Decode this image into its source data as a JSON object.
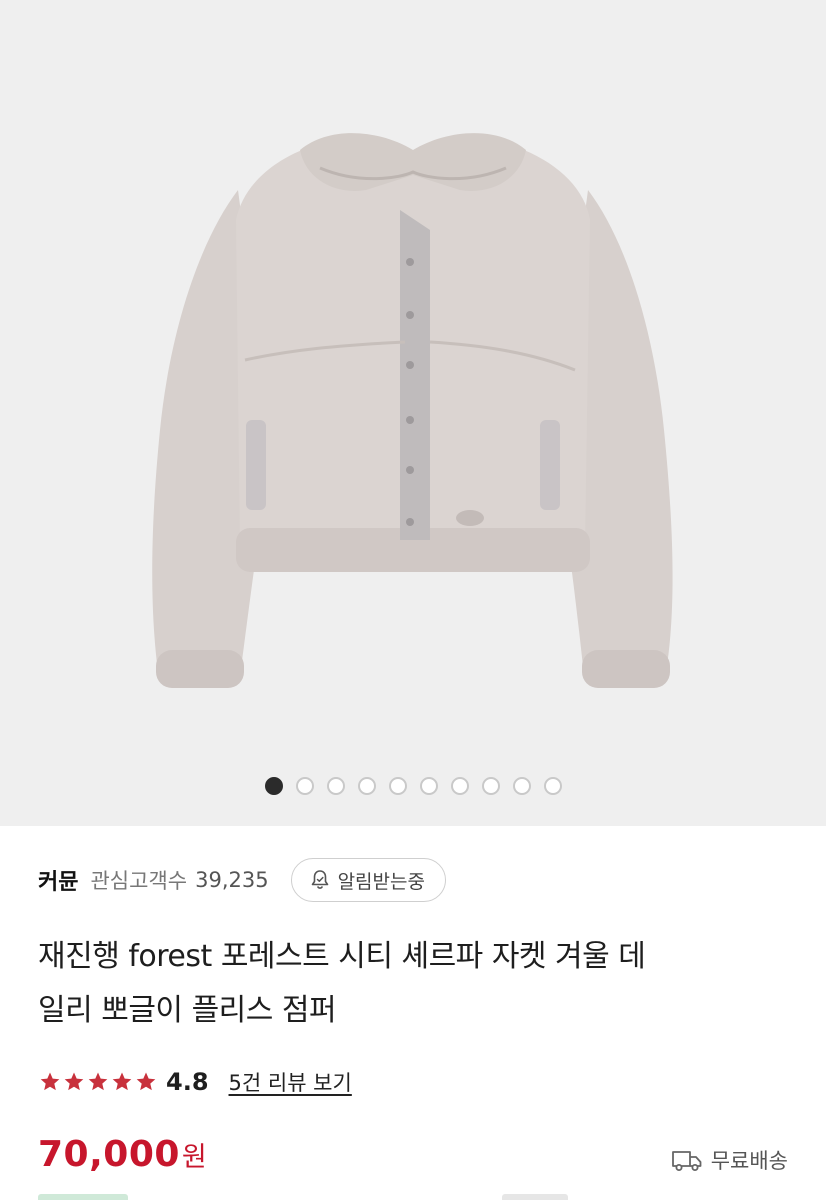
{
  "carousel": {
    "total": 10,
    "active_index": 0
  },
  "seller": {
    "name": "커뮨",
    "followers_label": "관심고객수",
    "followers_count": "39,235",
    "alert_label": "알림받는중"
  },
  "product": {
    "title_line1": "재진행 forest 포레스트 시티 셰르파 자켓 겨울 데",
    "title_line2": "일리 뽀글이 플리스 점퍼",
    "rating": "4.8",
    "stars": 5,
    "review_link": "5건 리뷰 보기",
    "price": "70,000",
    "currency": "원",
    "shipping_label": "무료배송"
  },
  "icons": {
    "bell": "bell-icon",
    "star": "star-icon",
    "truck": "truck-icon"
  },
  "colors": {
    "price": "#c7162c",
    "star": "#c8313c",
    "image_bg": "#efefef"
  }
}
